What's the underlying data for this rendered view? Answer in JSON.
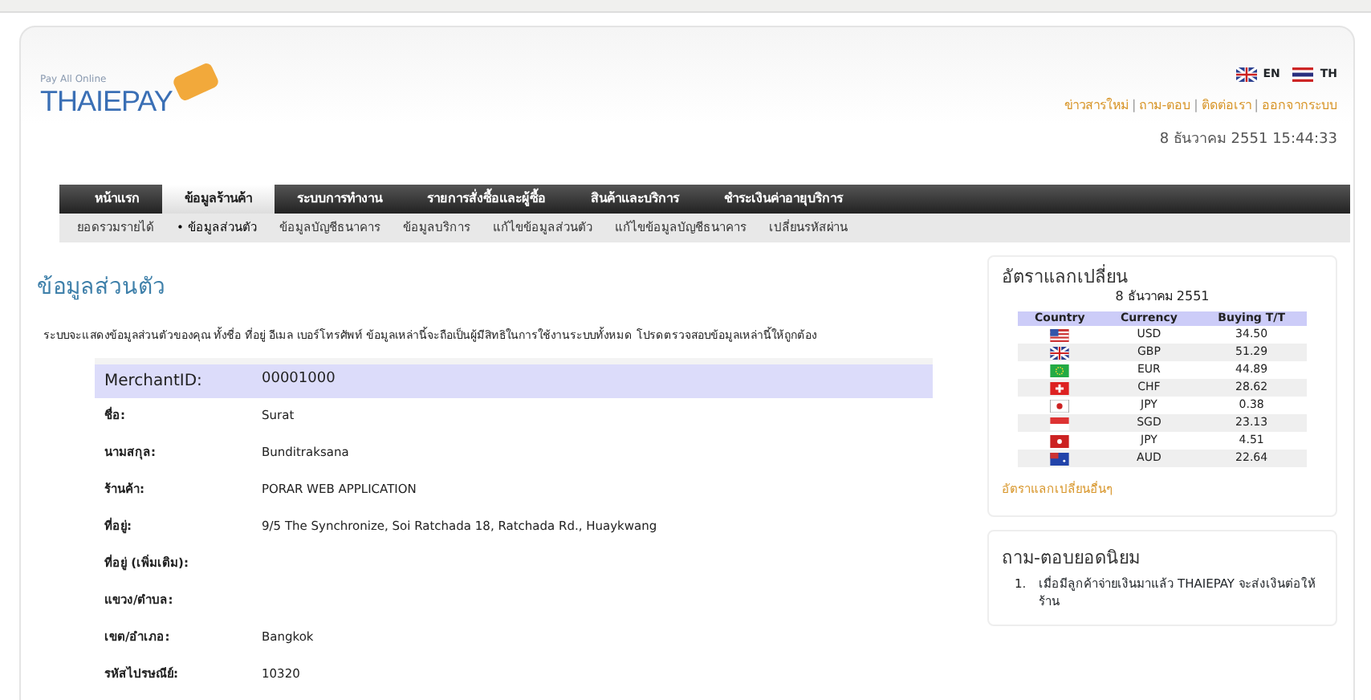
{
  "header": {
    "logo_tagline": "Pay All Online",
    "logo_text": "THAIEPAY",
    "languages": [
      {
        "label": "EN",
        "kind": "uk"
      },
      {
        "label": "TH",
        "kind": "th"
      }
    ],
    "top_links": [
      "ข่าวสารใหม่",
      "ถาม-ตอบ",
      "ติดต่อเรา",
      "ออกจากระบบ"
    ],
    "link_separator": "|",
    "datetime": "8 ธันวาคม 2551 15:44:33"
  },
  "nav": [
    {
      "label": "หน้าแรก",
      "selected": false
    },
    {
      "label": "ข้อมูลร้านค้า",
      "selected": true
    },
    {
      "label": "ระบบการทำงาน",
      "selected": false
    },
    {
      "label": "รายการสั่งซื้อและผู้ซื้อ",
      "selected": false
    },
    {
      "label": "สินค้าและบริการ",
      "selected": false
    },
    {
      "label": "ชำระเงินค่าอายุบริการ",
      "selected": false
    }
  ],
  "subnav": [
    {
      "label": "ยอดรวมรายได้",
      "selected": false
    },
    {
      "label": "ข้อมูลส่วนตัว",
      "selected": true,
      "bullet": "•"
    },
    {
      "label": "ข้อมูลบัญชีธนาคาร",
      "selected": false
    },
    {
      "label": "ข้อมูลบริการ",
      "selected": false
    },
    {
      "label": "แก้ไขข้อมูลส่วนตัว",
      "selected": false
    },
    {
      "label": "แก้ไขข้อมูลบัญชีธนาคาร",
      "selected": false
    },
    {
      "label": "เปลี่ยนรหัสผ่าน",
      "selected": false
    }
  ],
  "main": {
    "title": "ข้อมูลส่วนตัว",
    "description": "ระบบจะแสดงข้อมูลส่วนตัวของคุณ ทั้งชื่อ ที่อยู่ อีเมล เบอร์โทรศัพท์ ข้อมูลเหล่านี้จะถือเป็นผู้มีสิทธิในการใช้งานระบบทั้งหมด โปรดตรวจสอบข้อมูลเหล่านี้ให้ถูกต้อง",
    "fields": [
      {
        "label": "MerchantID:",
        "value": "00001000",
        "kind": "header"
      },
      {
        "label": "ชื่อ:",
        "value": "Surat",
        "kind": "plain"
      },
      {
        "label": "นามสกุล:",
        "value": "Bunditraksana",
        "kind": "plain"
      },
      {
        "label": "ร้านค้า:",
        "value": "PORAR WEB APPLICATION",
        "kind": "plain"
      },
      {
        "label": "ที่อยู่:",
        "value": "9/5 The Synchronize, Soi Ratchada 18, Ratchada Rd., Huaykwang",
        "kind": "plain"
      },
      {
        "label": "ที่อยู่ (เพิ่มเติม):",
        "kind": "plain"
      },
      {
        "label": "แขวง/ตำบล:",
        "kind": "plain"
      },
      {
        "label": "เขต/อำเภอ:",
        "value": "Bangkok",
        "kind": "plain"
      },
      {
        "label": "รหัสไปรษณีย์:",
        "value": "10320",
        "kind": "plain"
      }
    ]
  },
  "sidebar": {
    "exchange": {
      "title": "อัตราแลกเปลี่ยน",
      "date": "8 ธันวาคม 2551",
      "columns": [
        "Country",
        "Currency",
        "Buying T/T"
      ],
      "rows": [
        {
          "kind": "us",
          "currency": "USD",
          "rate": "34.50"
        },
        {
          "kind": "uk",
          "currency": "GBP",
          "rate": "51.29"
        },
        {
          "kind": "eu",
          "currency": "EUR",
          "rate": "44.89"
        },
        {
          "kind": "ch",
          "currency": "CHF",
          "rate": "28.62"
        },
        {
          "kind": "jp",
          "currency": "JPY",
          "rate": "0.38"
        },
        {
          "kind": "sg",
          "currency": "SGD",
          "rate": "23.13"
        },
        {
          "kind": "hk",
          "currency": "JPY",
          "rate": "4.51"
        },
        {
          "kind": "au",
          "currency": "AUD",
          "rate": "22.64"
        }
      ],
      "more_link": "อัตราแลกเปลี่ยนอื่นๆ"
    },
    "faq": {
      "title": "ถาม-ตอบยอดนิยม",
      "items": [
        {
          "number": "1.",
          "text": "เมื่อมีลูกค้าจ่ายเงินมาแล้ว THAIEPAY จะส่งเงินต่อให้ร้าน"
        }
      ]
    }
  }
}
